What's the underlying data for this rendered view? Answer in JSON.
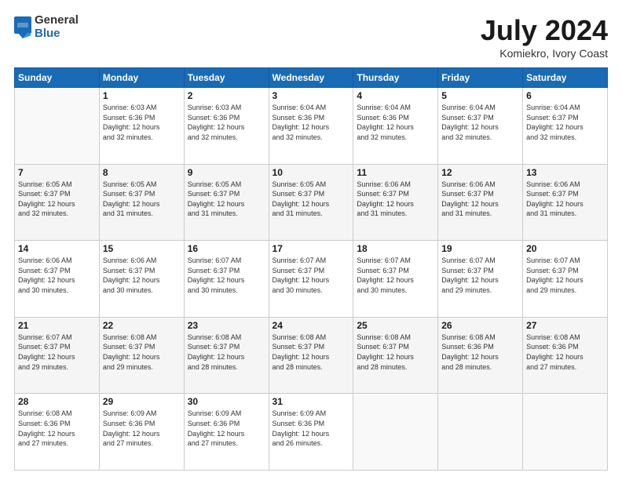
{
  "logo": {
    "general": "General",
    "blue": "Blue"
  },
  "header": {
    "title": "July 2024",
    "subtitle": "Komiekro, Ivory Coast"
  },
  "weekdays": [
    "Sunday",
    "Monday",
    "Tuesday",
    "Wednesday",
    "Thursday",
    "Friday",
    "Saturday"
  ],
  "weeks": [
    [
      {
        "day": "",
        "info": ""
      },
      {
        "day": "1",
        "info": "Sunrise: 6:03 AM\nSunset: 6:36 PM\nDaylight: 12 hours\nand 32 minutes."
      },
      {
        "day": "2",
        "info": "Sunrise: 6:03 AM\nSunset: 6:36 PM\nDaylight: 12 hours\nand 32 minutes."
      },
      {
        "day": "3",
        "info": "Sunrise: 6:04 AM\nSunset: 6:36 PM\nDaylight: 12 hours\nand 32 minutes."
      },
      {
        "day": "4",
        "info": "Sunrise: 6:04 AM\nSunset: 6:36 PM\nDaylight: 12 hours\nand 32 minutes."
      },
      {
        "day": "5",
        "info": "Sunrise: 6:04 AM\nSunset: 6:37 PM\nDaylight: 12 hours\nand 32 minutes."
      },
      {
        "day": "6",
        "info": "Sunrise: 6:04 AM\nSunset: 6:37 PM\nDaylight: 12 hours\nand 32 minutes."
      }
    ],
    [
      {
        "day": "7",
        "info": "Sunrise: 6:05 AM\nSunset: 6:37 PM\nDaylight: 12 hours\nand 32 minutes."
      },
      {
        "day": "8",
        "info": "Sunrise: 6:05 AM\nSunset: 6:37 PM\nDaylight: 12 hours\nand 31 minutes."
      },
      {
        "day": "9",
        "info": "Sunrise: 6:05 AM\nSunset: 6:37 PM\nDaylight: 12 hours\nand 31 minutes."
      },
      {
        "day": "10",
        "info": "Sunrise: 6:05 AM\nSunset: 6:37 PM\nDaylight: 12 hours\nand 31 minutes."
      },
      {
        "day": "11",
        "info": "Sunrise: 6:06 AM\nSunset: 6:37 PM\nDaylight: 12 hours\nand 31 minutes."
      },
      {
        "day": "12",
        "info": "Sunrise: 6:06 AM\nSunset: 6:37 PM\nDaylight: 12 hours\nand 31 minutes."
      },
      {
        "day": "13",
        "info": "Sunrise: 6:06 AM\nSunset: 6:37 PM\nDaylight: 12 hours\nand 31 minutes."
      }
    ],
    [
      {
        "day": "14",
        "info": "Sunrise: 6:06 AM\nSunset: 6:37 PM\nDaylight: 12 hours\nand 30 minutes."
      },
      {
        "day": "15",
        "info": "Sunrise: 6:06 AM\nSunset: 6:37 PM\nDaylight: 12 hours\nand 30 minutes."
      },
      {
        "day": "16",
        "info": "Sunrise: 6:07 AM\nSunset: 6:37 PM\nDaylight: 12 hours\nand 30 minutes."
      },
      {
        "day": "17",
        "info": "Sunrise: 6:07 AM\nSunset: 6:37 PM\nDaylight: 12 hours\nand 30 minutes."
      },
      {
        "day": "18",
        "info": "Sunrise: 6:07 AM\nSunset: 6:37 PM\nDaylight: 12 hours\nand 30 minutes."
      },
      {
        "day": "19",
        "info": "Sunrise: 6:07 AM\nSunset: 6:37 PM\nDaylight: 12 hours\nand 29 minutes."
      },
      {
        "day": "20",
        "info": "Sunrise: 6:07 AM\nSunset: 6:37 PM\nDaylight: 12 hours\nand 29 minutes."
      }
    ],
    [
      {
        "day": "21",
        "info": "Sunrise: 6:07 AM\nSunset: 6:37 PM\nDaylight: 12 hours\nand 29 minutes."
      },
      {
        "day": "22",
        "info": "Sunrise: 6:08 AM\nSunset: 6:37 PM\nDaylight: 12 hours\nand 29 minutes."
      },
      {
        "day": "23",
        "info": "Sunrise: 6:08 AM\nSunset: 6:37 PM\nDaylight: 12 hours\nand 28 minutes."
      },
      {
        "day": "24",
        "info": "Sunrise: 6:08 AM\nSunset: 6:37 PM\nDaylight: 12 hours\nand 28 minutes."
      },
      {
        "day": "25",
        "info": "Sunrise: 6:08 AM\nSunset: 6:37 PM\nDaylight: 12 hours\nand 28 minutes."
      },
      {
        "day": "26",
        "info": "Sunrise: 6:08 AM\nSunset: 6:36 PM\nDaylight: 12 hours\nand 28 minutes."
      },
      {
        "day": "27",
        "info": "Sunrise: 6:08 AM\nSunset: 6:36 PM\nDaylight: 12 hours\nand 27 minutes."
      }
    ],
    [
      {
        "day": "28",
        "info": "Sunrise: 6:08 AM\nSunset: 6:36 PM\nDaylight: 12 hours\nand 27 minutes."
      },
      {
        "day": "29",
        "info": "Sunrise: 6:09 AM\nSunset: 6:36 PM\nDaylight: 12 hours\nand 27 minutes."
      },
      {
        "day": "30",
        "info": "Sunrise: 6:09 AM\nSunset: 6:36 PM\nDaylight: 12 hours\nand 27 minutes."
      },
      {
        "day": "31",
        "info": "Sunrise: 6:09 AM\nSunset: 6:36 PM\nDaylight: 12 hours\nand 26 minutes."
      },
      {
        "day": "",
        "info": ""
      },
      {
        "day": "",
        "info": ""
      },
      {
        "day": "",
        "info": ""
      }
    ]
  ]
}
